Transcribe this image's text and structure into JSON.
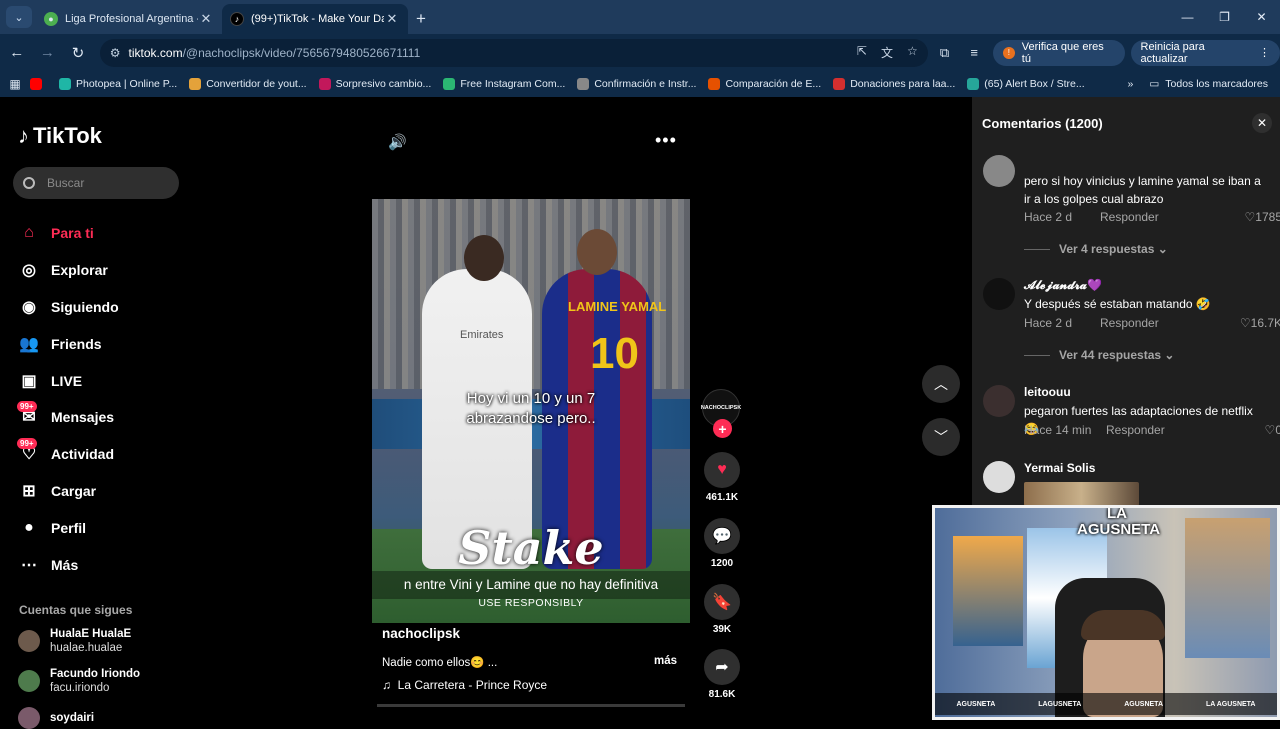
{
  "browser": {
    "tabs": [
      {
        "title": "Liga Profesional Argentina - PO",
        "favicon_color": "#4caf50",
        "active": false
      },
      {
        "title": "(99+)TikTok - Make Your Day",
        "favicon_color": "#000000",
        "active": true
      }
    ],
    "url_host": "tiktok.com",
    "url_path": "/@nachoclipsk/video/7565679480526671111",
    "profile_pill": "Verifica que eres tú",
    "update_pill": "Reinicia para actualizar",
    "bookmarks": [
      {
        "label": "",
        "color": "#ff0000"
      },
      {
        "label": "Photopea | Online P...",
        "color": "#1fb6a6"
      },
      {
        "label": "Convertidor de yout...",
        "color": "#e4a23a"
      },
      {
        "label": "Sorpresivo cambio...",
        "color": "#c2185b"
      },
      {
        "label": "Free Instagram Com...",
        "color": "#2bb673"
      },
      {
        "label": "Confirmación e Instr...",
        "color": "#888888"
      },
      {
        "label": "Comparación de E...",
        "color": "#e65100"
      },
      {
        "label": "Donaciones para laa...",
        "color": "#d32f2f"
      },
      {
        "label": "(65) Alert Box / Stre...",
        "color": "#26a69a"
      }
    ],
    "bookmarks_more": "»",
    "all_bookmarks": "Todos los marcadores"
  },
  "sidebar": {
    "logo": "TikTok",
    "search_placeholder": "Buscar",
    "nav": [
      {
        "label": "Para ti",
        "icon": "home-icon",
        "active": true,
        "badge": ""
      },
      {
        "label": "Explorar",
        "icon": "compass-icon",
        "active": false,
        "badge": ""
      },
      {
        "label": "Siguiendo",
        "icon": "following-icon",
        "active": false,
        "badge": ""
      },
      {
        "label": "Friends",
        "icon": "friends-icon",
        "active": false,
        "badge": ""
      },
      {
        "label": "LIVE",
        "icon": "live-icon",
        "active": false,
        "badge": ""
      },
      {
        "label": "Mensajes",
        "icon": "messages-icon",
        "active": false,
        "badge": "99+"
      },
      {
        "label": "Actividad",
        "icon": "activity-icon",
        "active": false,
        "badge": "99+"
      },
      {
        "label": "Cargar",
        "icon": "upload-icon",
        "active": false,
        "badge": ""
      },
      {
        "label": "Perfil",
        "icon": "profile-icon",
        "active": false,
        "badge": ""
      },
      {
        "label": "Más",
        "icon": "more-icon",
        "active": false,
        "badge": ""
      }
    ],
    "following_title": "Cuentas que sigues",
    "following": [
      {
        "name": "HualaE HualaE",
        "handle": "hualae.hualae"
      },
      {
        "name": "Facundo Iriondo",
        "handle": "facu.iriondo"
      },
      {
        "name": "soydairi",
        "handle": ""
      }
    ]
  },
  "video": {
    "caption_line1": "Hoy vi un 10 y un 7",
    "caption_line2": "abrazandose pero..",
    "jersey_name": "LAMINE YAMAL",
    "jersey_number": "10",
    "sponsor": "Emirates",
    "ad_brand": "Stake",
    "subtitle": "n entre Vini y Lamine que no hay definitiva",
    "ad_tagline": "USE RESPONSIBLY",
    "author": "nachoclipsk",
    "description": "Nadie como ellos😊 ...",
    "more_label": "más",
    "music": "La Carretera - Prince Royce",
    "author_avatar_text": "NACHOCLIPSK",
    "progress": 0.0
  },
  "actions": {
    "likes": "461.1K",
    "comments": "1200",
    "saves": "39K",
    "shares": "81.6K"
  },
  "comments_panel": {
    "title": "Comentarios (1200)",
    "comments": [
      {
        "user": "",
        "text": "pero si hoy vinicius y lamine yamal se iban a ir a los golpes cual abrazo",
        "time": "Hace 2 d",
        "reply": "Responder",
        "likes": "1785",
        "more": "Ver 4 respuestas"
      },
      {
        "user": "𝓐𝓵𝓮𝓳𝓪𝓷𝓭𝓻𝓪💜",
        "text": "Y después sé estaban matando 🤣",
        "time": "Hace 2 d",
        "reply": "Responder",
        "likes": "16.7K",
        "more": "Ver 44 respuestas"
      },
      {
        "user": "leitoouu",
        "text": "pegaron fuertes las adaptaciones de netflix😂",
        "time": "Hace 14 min",
        "reply": "Responder",
        "likes": "0",
        "more": ""
      },
      {
        "user": "Yermai Solis",
        "text": "",
        "time": "",
        "reply": "",
        "likes": "",
        "more": ""
      }
    ]
  },
  "webcam": {
    "logo_line1": "LA",
    "logo_line2": "AGUSNETA",
    "socials": [
      "AGUSNETA",
      "LAGUSNETA",
      "AGUSNETA",
      "LA AGUSNETA"
    ]
  },
  "colors": {
    "accent": "#fe2c55",
    "chrome_tabs": "#1f3b5c",
    "chrome_toolbar": "#0f2a47",
    "comments_bg": "#1f1f1f"
  }
}
